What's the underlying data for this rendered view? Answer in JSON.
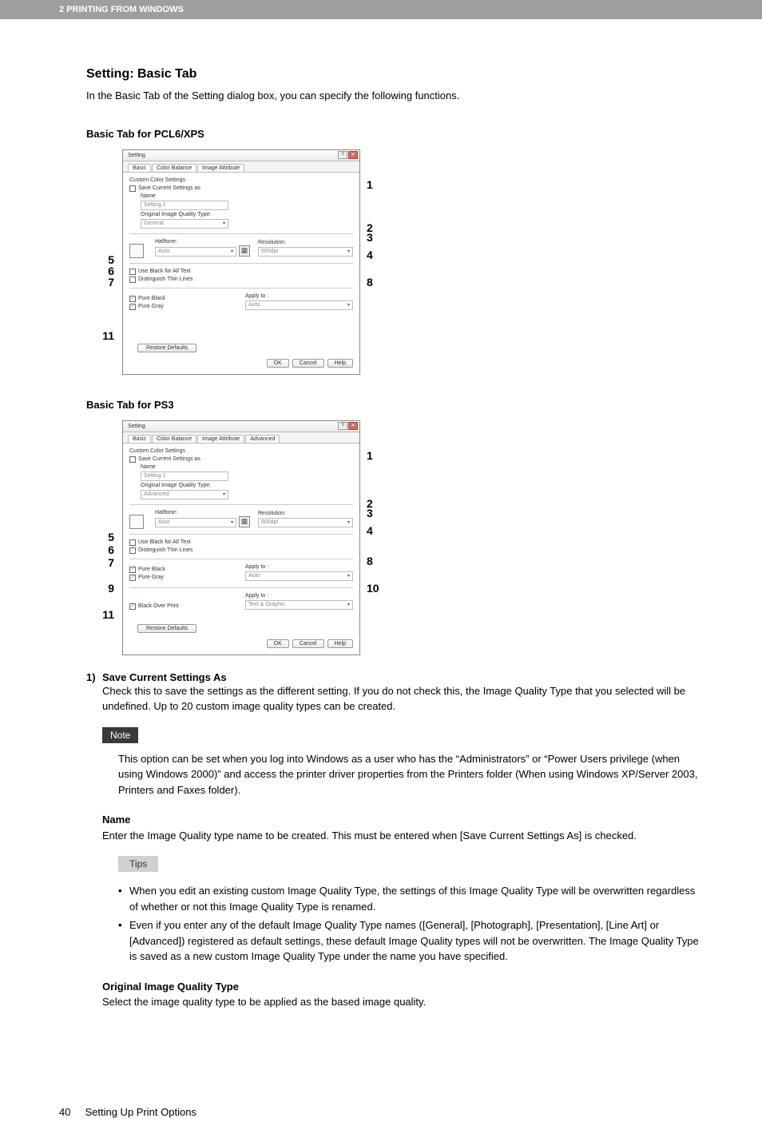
{
  "header": {
    "chapter": "2 PRINTING FROM WINDOWS"
  },
  "section": {
    "title": "Setting: Basic Tab",
    "intro": "In the Basic Tab of the Setting dialog box, you can specify the following functions."
  },
  "sub1": {
    "title": "Basic Tab for PCL6/XPS"
  },
  "sub2": {
    "title": "Basic Tab for PS3"
  },
  "dialog": {
    "title": "Setting",
    "tabs": {
      "basic": "Basic",
      "colorBalance": "Color Balance",
      "imageAttr": "Image Attribute",
      "advanced": "Advanced"
    },
    "group": "Custom Color Settings",
    "saveAs": "Save Current Settings as",
    "nameLabel": "Name",
    "nameValue": "Setting 1",
    "origLabel": "Original Image Quality Type:",
    "origValueGeneral": "General",
    "origValueAdvanced": "Advanced",
    "halftoneLabel": "Halftone:",
    "halftoneValue": "Auto",
    "resolutionLabel": "Resolution:",
    "resolutionValue": "600dpi",
    "useBlackAll": "Use Black for All Text",
    "distinguish": "Distinguish Thin Lines",
    "pureBlack": "Pure Black",
    "pureGray": "Pure Gray",
    "applyTo": "Apply to :",
    "applyValue": "Auto",
    "blackOverPrint": "Black Over Print",
    "applyValue2": "Text & Graphic",
    "restore": "Restore Defaults",
    "ok": "OK",
    "cancel": "Cancel",
    "help": "Help"
  },
  "callouts": {
    "n1": "1",
    "n2": "2",
    "n3": "3",
    "n4": "4",
    "n5": "5",
    "n6": "6",
    "n7": "7",
    "n8": "8",
    "n9": "9",
    "n10": "10",
    "n11": "11"
  },
  "item1": {
    "num": "1)",
    "title": "Save Current Settings As",
    "body": "Check this to save the settings as the different setting.  If you do not check this, the Image Quality Type that you selected will be undefined. Up to 20 custom image quality types can be created."
  },
  "note": {
    "label": "Note",
    "body": "This option can be set when you log into Windows as a user who has the “Administrators” or “Power Users privilege (when using Windows 2000)” and access the printer driver properties from the Printers folder (When using Windows XP/Server 2003, Printers and Faxes folder)."
  },
  "nameSection": {
    "title": "Name",
    "body": "Enter the Image Quality type name to be created.  This must be entered when [Save Current Settings As] is checked."
  },
  "tips": {
    "label": "Tips",
    "li1": "When you edit an existing custom Image Quality Type, the settings of this Image Quality Type will be overwritten regardless of whether or not this Image Quality Type is renamed.",
    "li2": "Even if you enter any of the default Image Quality Type names ([General], [Photograph], [Presentation], [Line Art] or [Advanced]) registered as default settings, these default Image Quality types will not be overwritten. The Image Quality Type is saved as a new custom Image Quality Type under the name you have specified."
  },
  "orig": {
    "title": "Original Image Quality Type",
    "body": "Select the image quality type to be applied as the based image quality."
  },
  "footer": {
    "page": "40",
    "text": "Setting Up Print Options"
  }
}
